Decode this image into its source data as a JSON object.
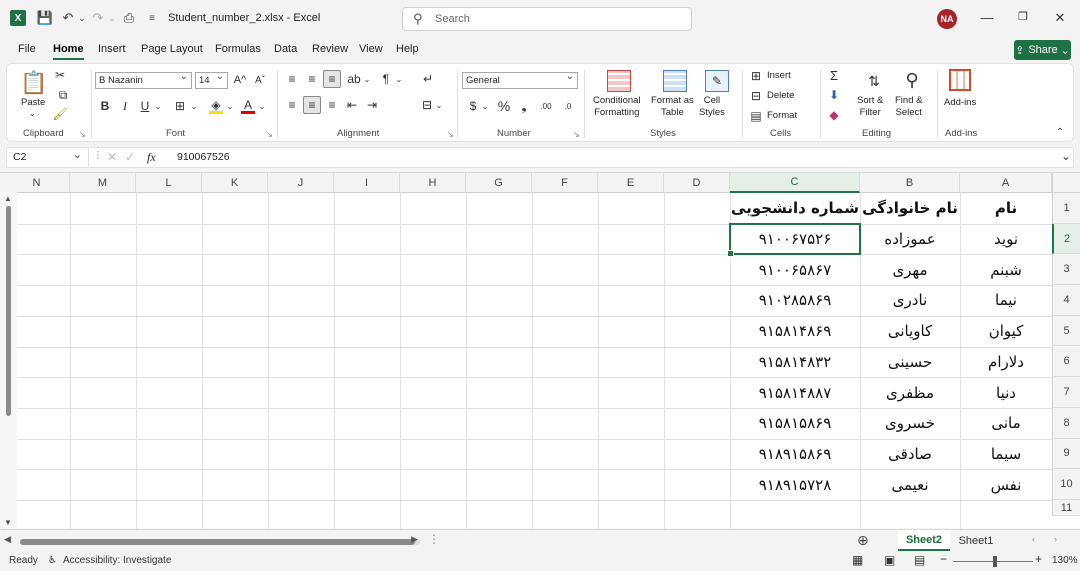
{
  "window": {
    "filename": "Student_number_2.xlsx",
    "app": "Excel",
    "separator": "-",
    "search_placeholder": "Search",
    "user_initials": "NA"
  },
  "menu": [
    "File",
    "Home",
    "Insert",
    "Page Layout",
    "Formulas",
    "Data",
    "Review",
    "View",
    "Help"
  ],
  "share_label": "Share",
  "ribbon": {
    "clipboard": {
      "paste": "Paste",
      "label": "Clipboard"
    },
    "font": {
      "name": "B Nazanin",
      "size": "14",
      "label": "Font"
    },
    "alignment": {
      "label": "Alignment"
    },
    "number": {
      "format": "General",
      "label": "Number"
    },
    "styles": {
      "conditional": [
        "Conditional",
        "Formatting"
      ],
      "format_as_table": [
        "Format as",
        "Table"
      ],
      "cell_styles": [
        "Cell",
        "Styles"
      ],
      "label": "Styles"
    },
    "cells": {
      "insert": "Insert",
      "delete": "Delete",
      "format": "Format",
      "label": "Cells"
    },
    "editing": {
      "sort": [
        "Sort &",
        "Filter"
      ],
      "find": [
        "Find &",
        "Select"
      ],
      "label": "Editing"
    },
    "addins": {
      "button": "Add-ins",
      "label": "Add-ins"
    }
  },
  "formula_bar": {
    "name_box": "C2",
    "fx": "fx",
    "content": "910067526"
  },
  "grid": {
    "columns_rtl": [
      "A",
      "B",
      "C",
      "D",
      "E",
      "F",
      "G",
      "H",
      "I",
      "J",
      "K",
      "L",
      "M",
      "N"
    ],
    "rows": [
      "1",
      "2",
      "3",
      "4",
      "5",
      "6",
      "7",
      "8",
      "9",
      "10",
      "11"
    ],
    "selected_cell": "C2",
    "headers": {
      "A": "نام",
      "B": "نام خانوادگی",
      "C": "شماره دانشجویی"
    },
    "records": [
      {
        "first": "نوید",
        "last": "عموزاده",
        "number": "۹۱۰۰۶۷۵۲۶"
      },
      {
        "first": "شبنم",
        "last": "مهری",
        "number": "۹۱۰۰۶۵۸۶۷"
      },
      {
        "first": "نیما",
        "last": "نادری",
        "number": "۹۱۰۲۸۵۸۶۹"
      },
      {
        "first": "کیوان",
        "last": "کاویانی",
        "number": "۹۱۵۸۱۴۸۶۹"
      },
      {
        "first": "دلارام",
        "last": "حسینی",
        "number": "۹۱۵۸۱۴۸۳۲"
      },
      {
        "first": "دنیا",
        "last": "مظفری",
        "number": "۹۱۵۸۱۴۸۸۷"
      },
      {
        "first": "مانی",
        "last": "خسروی",
        "number": "۹۱۵۸۱۵۸۶۹"
      },
      {
        "first": "سیما",
        "last": "صادقی",
        "number": "۹۱۸۹۱۵۸۶۹"
      },
      {
        "first": "نفس",
        "last": "نعیمی",
        "number": "۹۱۸۹۱۵۷۲۸"
      }
    ]
  },
  "sheets": [
    {
      "name": "Sheet2",
      "active": true
    },
    {
      "name": "Sheet1",
      "active": false
    }
  ],
  "status": {
    "ready": "Ready",
    "accessibility": "Accessibility: Investigate",
    "zoom": "130%"
  },
  "colors": {
    "accent": "#217346",
    "avatar": "#a4262c"
  }
}
